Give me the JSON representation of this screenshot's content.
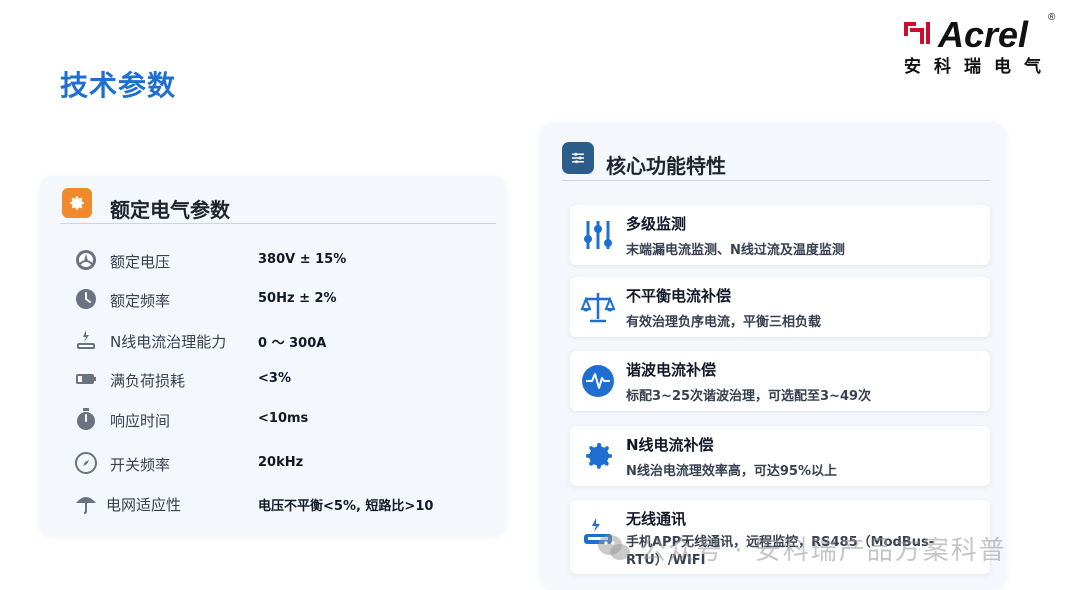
{
  "page": {
    "title": "技术参数"
  },
  "logo": {
    "brand": "Acrel",
    "registered": "®",
    "cn_name": "安科瑞电气",
    "color_mark": "#c8102e"
  },
  "left_card": {
    "title": "额定电气参数",
    "icon": "gear-icon",
    "accent": "#f08a2c",
    "params": [
      {
        "icon": "voltage-gauge-icon",
        "label": "额定电压",
        "value": "380V ± 15%"
      },
      {
        "icon": "clock-icon",
        "label": "额定频率",
        "value": "50Hz ± 2%"
      },
      {
        "icon": "lightning-plate-icon",
        "label": "N线电流治理能力",
        "value": "0 ～ 300A"
      },
      {
        "icon": "battery-icon",
        "label": "满负荷损耗",
        "value": "<3%"
      },
      {
        "icon": "stopwatch-icon",
        "label": "响应时间",
        "value": "<10ms"
      },
      {
        "icon": "compass-icon",
        "label": "开关频率",
        "value": "20kHz"
      },
      {
        "icon": "umbrella-icon",
        "label": "电网适应性",
        "value": "电压不平衡<5%, 短路比>10"
      }
    ]
  },
  "right_card": {
    "title": "核心功能特性",
    "icon": "sliders-icon",
    "accent": "#2c5c8a",
    "features": [
      {
        "icon": "level-meters-icon",
        "title": "多级监测",
        "desc": "末端漏电流监测、N线过流及温度监测"
      },
      {
        "icon": "balance-scale-icon",
        "title": "不平衡电流补偿",
        "desc": "有效治理负序电流，平衡三相负载"
      },
      {
        "icon": "waveform-icon",
        "title": "谐波电流补偿",
        "desc": "标配3~25次谐波治理，可选配至3~49次"
      },
      {
        "icon": "cog-icon",
        "title": "N线电流补偿",
        "desc": "N线治电流理效率高，可达95%以上"
      },
      {
        "icon": "wireless-device-icon",
        "title": "无线通讯",
        "desc": "手机APP无线通讯，远程监控，RS485（ModBus-RTU）/WIFI"
      }
    ]
  },
  "watermark": {
    "text": "公众号 · 安科瑞产品方案科普"
  }
}
